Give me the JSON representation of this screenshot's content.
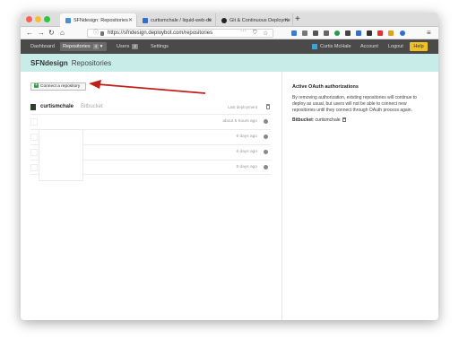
{
  "browser": {
    "tabs": [
      {
        "label": "SFNdesign: Repositories",
        "active": true,
        "favicon_color": "#4a90d9"
      },
      {
        "label": "curtismchale / liquid-web-deplo…",
        "active": false,
        "favicon_color": "#2f6fd1"
      },
      {
        "label": "Git & Continuous Deployment…",
        "active": false,
        "favicon_color": "#222222"
      }
    ],
    "url": "https://sfndesign.deploybot.com/repositories"
  },
  "site_nav": {
    "dashboard": "Dashboard",
    "repositories": "Repositories",
    "repositories_count": "4",
    "users": "Users",
    "users_count": "2",
    "settings": "Settings",
    "user_name": "Curtis McHale",
    "account": "Account",
    "logout": "Logout",
    "help": "Help"
  },
  "banner": {
    "project": "SFNdesign",
    "section": "Repositories"
  },
  "main": {
    "connect_button": "Connect a repository",
    "repo": {
      "name": "curtismchale",
      "source": "Bitbucket",
      "last_deployment_label": "Last deployment"
    },
    "rows": [
      {
        "time": "about 5 hours ago"
      },
      {
        "time": "6 days ago"
      },
      {
        "time": "6 days ago"
      },
      {
        "time": "6 days ago"
      }
    ]
  },
  "sidebar": {
    "title": "Active OAuth authorizations",
    "description": "By removing authorization, existing repositories will continue to deploy as usual, but users will not be able to connect new repositories until they connect through OAuth process again.",
    "provider_label": "Bitbucket",
    "provider_user": ": curtismchale"
  },
  "colors": {
    "accent_banner": "#c8ede8",
    "nav_bg": "#4a4a4a",
    "help_yellow": "#f0c020",
    "arrow_red": "#c0201a",
    "connect_plus": "#3b9b4b"
  }
}
